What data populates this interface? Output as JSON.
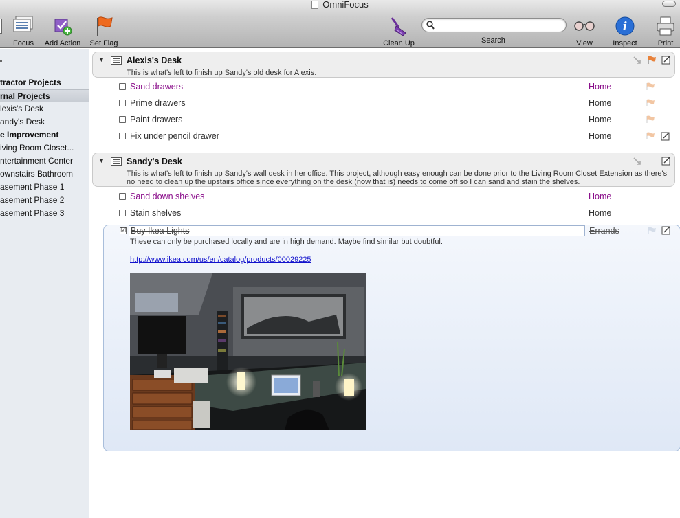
{
  "window": {
    "title": "OmniFocus"
  },
  "toolbar": {
    "focus_label": "Focus",
    "add_action_label": "Add Action",
    "set_flag_label": "Set Flag",
    "clean_up_label": "Clean Up",
    "search_label": "Search",
    "search_value": "",
    "view_label": "View",
    "inspect_label": "Inspect",
    "print_label": "Print"
  },
  "sidebar": {
    "items": [
      {
        "label": "tractor Projects",
        "bold": true
      },
      {
        "label": "rnal Projects",
        "bold": true,
        "selected": true
      },
      {
        "label": "lexis's Desk"
      },
      {
        "label": "andy's Desk"
      },
      {
        "label": "e Improvement",
        "bold": true
      },
      {
        "label": "iving Room Closet..."
      },
      {
        "label": "ntertainment Center"
      },
      {
        "label": "ownstairs Bathroom"
      },
      {
        "label": "asement Phase 1"
      },
      {
        "label": "asement Phase 2"
      },
      {
        "label": "asement Phase 3"
      }
    ]
  },
  "projects": [
    {
      "name": "Alexis's Desk",
      "note": "This is what's left to finish up Sandy's old desk for Alexis.",
      "tasks": [
        {
          "name": "Sand drawers",
          "context": "Home",
          "highlight": true
        },
        {
          "name": "Prime drawers",
          "context": "Home"
        },
        {
          "name": "Paint drawers",
          "context": "Home"
        },
        {
          "name": "Fix under pencil drawer",
          "context": "Home"
        }
      ]
    },
    {
      "name": "Sandy's Desk",
      "note": "This is what's left to finish up Sandy's wall desk in her office.  This project, although easy enough can be done prior to the Living Room Closet Extension as there's no need to clean up the upstairs office since everything on the desk (now that is) needs to come off so I can sand and stain the shelves.",
      "tasks": [
        {
          "name": "Sand down shelves",
          "context": "Home",
          "highlight": true
        },
        {
          "name": "Stain shelves",
          "context": "Home"
        }
      ],
      "expanded_task": {
        "name": "Buy Ikea Lights",
        "context": "Errands",
        "checkbox": "☑",
        "note": "These can only be purchased locally and are in high demand.  Maybe find similar but doubtful.",
        "link": "http://www.ikea.com/us/en/catalog/products/00029225"
      }
    }
  ],
  "colors": {
    "context_purple": "#8a0d8a",
    "flag_orange": "#e8823b",
    "selection_blue": "#dfe8f6"
  },
  "icons": [
    "focus-icon",
    "add-action-icon",
    "set-flag-icon",
    "clean-up-icon",
    "search-icon",
    "view-icon",
    "inspect-icon",
    "print-icon",
    "flag-icon",
    "note-icon",
    "arrow-icon",
    "list-icon",
    "disclosure-triangle-icon"
  ]
}
